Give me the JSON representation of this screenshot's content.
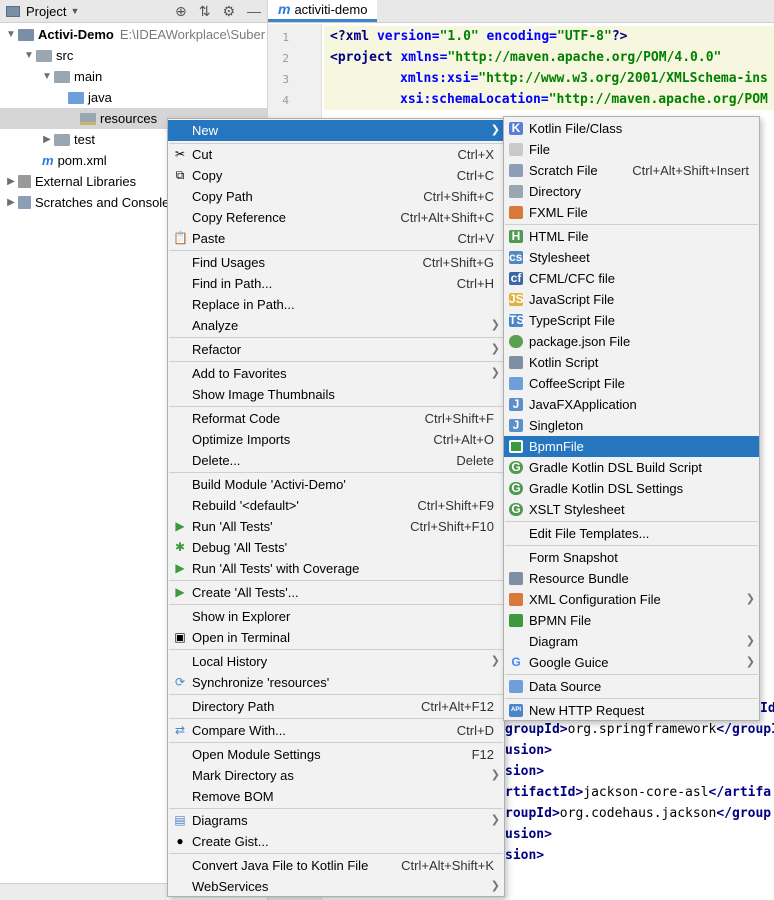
{
  "project_panel": {
    "title": "Project",
    "tree": {
      "module_name": "Activi-Demo",
      "module_path": "E:\\IDEAWorkplace\\Suber",
      "src": "src",
      "main": "main",
      "java": "java",
      "resources": "resources",
      "test": "test",
      "pom": "pom.xml",
      "external_libraries": "External Libraries",
      "scratches": "Scratches and Consoles"
    }
  },
  "editor": {
    "tab_label": "activiti-demo",
    "line_numbers": [
      "1",
      "2",
      "3",
      "4"
    ],
    "lines": {
      "l1": {
        "open": "<?",
        "tag": "xml",
        "attr1": " version=",
        "val1": "\"1.0\"",
        "attr2": " encoding=",
        "val2": "\"UTF-8\"",
        "close": "?>"
      },
      "l2": {
        "tag": "<project",
        "attr": " xmlns=",
        "val": "\"http://maven.apache.org/POM/4.0.0\""
      },
      "l3": {
        "attr": "xmlns:xsi=",
        "val": "\"http://www.w3.org/2001/XMLSchema-ins"
      },
      "l4": {
        "attr": "xsi:schemaLocation=",
        "val": "\"http://maven.apache.org/POM"
      }
    },
    "partial_lines": {
      "p1": {
        "a": "Id",
        "b": ""
      },
      "p2": {
        "tag1": "groupId>",
        "txt": "org.springframework",
        "tag2": "</groupI"
      },
      "p3": {
        "tag": "usion>"
      },
      "p4": {
        "tag": "sion>"
      },
      "p5": {
        "tag1": "rtifactId>",
        "txt": "jackson-core-asl",
        "tag2": "</artifa"
      },
      "p6": {
        "tag1": "roupId>",
        "txt": "org.codehaus.jackson",
        "tag2": "</group"
      },
      "p7": {
        "tag": "usion>"
      },
      "p8": {
        "tag": "sion>"
      }
    }
  },
  "context_menu": {
    "items": [
      {
        "label": "New",
        "shortcut": "",
        "submenu": true
      },
      {
        "label": "Cut",
        "shortcut": "Ctrl+X"
      },
      {
        "label": "Copy",
        "shortcut": "Ctrl+C"
      },
      {
        "label": "Copy Path",
        "shortcut": "Ctrl+Shift+C"
      },
      {
        "label": "Copy Reference",
        "shortcut": "Ctrl+Alt+Shift+C"
      },
      {
        "label": "Paste",
        "shortcut": "Ctrl+V"
      },
      {
        "label": "Find Usages",
        "shortcut": "Ctrl+Shift+G"
      },
      {
        "label": "Find in Path...",
        "shortcut": "Ctrl+H"
      },
      {
        "label": "Replace in Path...",
        "shortcut": ""
      },
      {
        "label": "Analyze",
        "shortcut": "",
        "submenu": true
      },
      {
        "label": "Refactor",
        "shortcut": "",
        "submenu": true
      },
      {
        "label": "Add to Favorites",
        "shortcut": "",
        "submenu": true
      },
      {
        "label": "Show Image Thumbnails",
        "shortcut": ""
      },
      {
        "label": "Reformat Code",
        "shortcut": "Ctrl+Shift+F"
      },
      {
        "label": "Optimize Imports",
        "shortcut": "Ctrl+Alt+O"
      },
      {
        "label": "Delete...",
        "shortcut": "Delete"
      },
      {
        "label": "Build Module 'Activi-Demo'",
        "shortcut": ""
      },
      {
        "label": "Rebuild '<default>'",
        "shortcut": "Ctrl+Shift+F9"
      },
      {
        "label": "Run 'All Tests'",
        "shortcut": "Ctrl+Shift+F10"
      },
      {
        "label": "Debug 'All Tests'",
        "shortcut": ""
      },
      {
        "label": "Run 'All Tests' with Coverage",
        "shortcut": ""
      },
      {
        "label": "Create 'All Tests'...",
        "shortcut": ""
      },
      {
        "label": "Show in Explorer",
        "shortcut": ""
      },
      {
        "label": "Open in Terminal",
        "shortcut": ""
      },
      {
        "label": "Local History",
        "shortcut": "",
        "submenu": true
      },
      {
        "label": "Synchronize 'resources'",
        "shortcut": ""
      },
      {
        "label": "Directory Path",
        "shortcut": "Ctrl+Alt+F12"
      },
      {
        "label": "Compare With...",
        "shortcut": "Ctrl+D"
      },
      {
        "label": "Open Module Settings",
        "shortcut": "F12"
      },
      {
        "label": "Mark Directory as",
        "shortcut": "",
        "submenu": true
      },
      {
        "label": "Remove BOM",
        "shortcut": ""
      },
      {
        "label": "Diagrams",
        "shortcut": "",
        "submenu": true
      },
      {
        "label": "Create Gist...",
        "shortcut": ""
      },
      {
        "label": "Convert Java File to Kotlin File",
        "shortcut": "Ctrl+Alt+Shift+K"
      },
      {
        "label": "WebServices",
        "shortcut": "",
        "submenu": true
      }
    ]
  },
  "new_submenu": {
    "items": [
      {
        "label": "Kotlin File/Class",
        "shortcut": ""
      },
      {
        "label": "File",
        "shortcut": ""
      },
      {
        "label": "Scratch File",
        "shortcut": "Ctrl+Alt+Shift+Insert"
      },
      {
        "label": "Directory",
        "shortcut": ""
      },
      {
        "label": "FXML File",
        "shortcut": ""
      },
      {
        "label": "HTML File",
        "shortcut": ""
      },
      {
        "label": "Stylesheet",
        "shortcut": ""
      },
      {
        "label": "CFML/CFC file",
        "shortcut": ""
      },
      {
        "label": "JavaScript File",
        "shortcut": ""
      },
      {
        "label": "TypeScript File",
        "shortcut": ""
      },
      {
        "label": "package.json File",
        "shortcut": ""
      },
      {
        "label": "Kotlin Script",
        "shortcut": ""
      },
      {
        "label": "CoffeeScript File",
        "shortcut": ""
      },
      {
        "label": "JavaFXApplication",
        "shortcut": ""
      },
      {
        "label": "Singleton",
        "shortcut": ""
      },
      {
        "label": "BpmnFile",
        "shortcut": ""
      },
      {
        "label": "Gradle Kotlin DSL Build Script",
        "shortcut": ""
      },
      {
        "label": "Gradle Kotlin DSL Settings",
        "shortcut": ""
      },
      {
        "label": "XSLT Stylesheet",
        "shortcut": ""
      },
      {
        "label": "Edit File Templates...",
        "shortcut": ""
      },
      {
        "label": "Form Snapshot",
        "shortcut": ""
      },
      {
        "label": "Resource Bundle",
        "shortcut": ""
      },
      {
        "label": "XML Configuration File",
        "shortcut": "",
        "submenu": true
      },
      {
        "label": "BPMN File",
        "shortcut": ""
      },
      {
        "label": "Diagram",
        "shortcut": "",
        "submenu": true
      },
      {
        "label": "Google Guice",
        "shortcut": "",
        "submenu": true
      },
      {
        "label": "Data Source",
        "shortcut": ""
      },
      {
        "label": "New HTTP Request",
        "shortcut": ""
      }
    ]
  },
  "icon_labels": {
    "html": "H",
    "css": "css",
    "cf": "cf",
    "js": "JS",
    "ts": "TS",
    "fx": "FX",
    "api": "API",
    "j": "J",
    "g": "G"
  },
  "colors": {
    "selection": "#2675bf",
    "menu_bg": "#f2f2f2",
    "accent_tab": "#4083c9"
  }
}
